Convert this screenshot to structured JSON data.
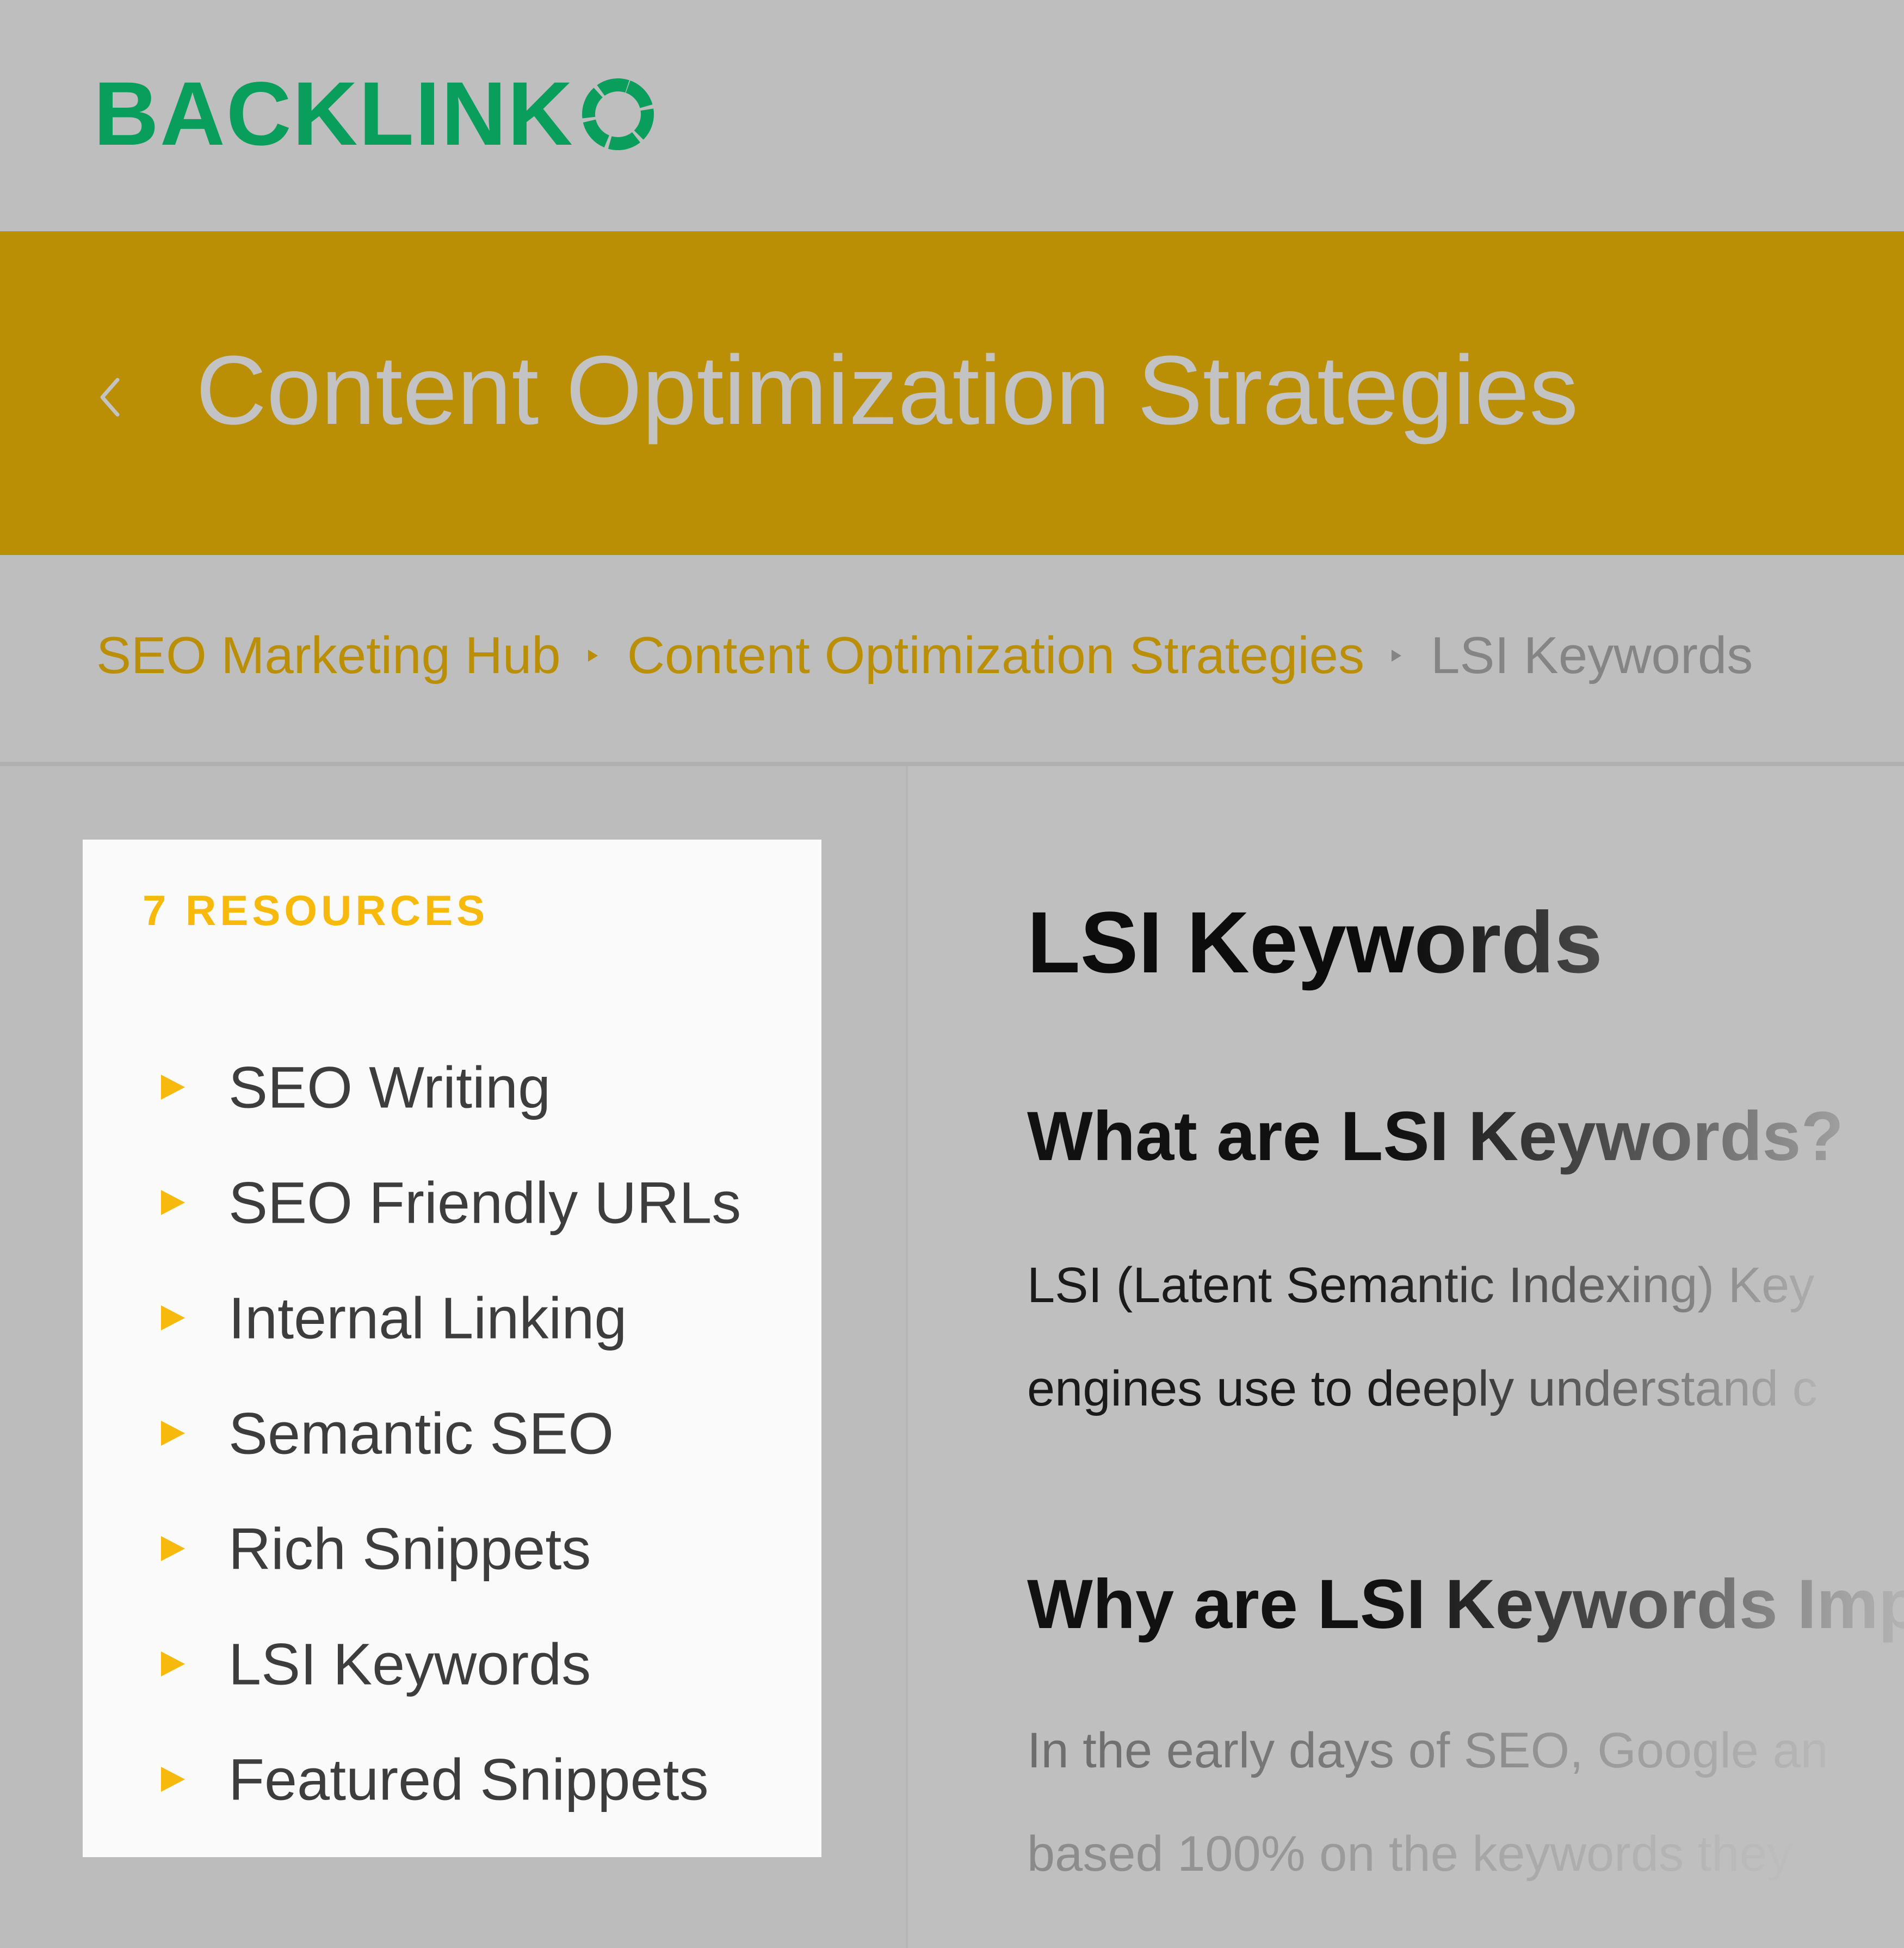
{
  "header": {
    "logo_text": "BACKLINK",
    "logo_color": "#0a9e5d"
  },
  "banner": {
    "title": "Content Optimization Strategies",
    "color": "#bb8f05"
  },
  "breadcrumb": {
    "items": [
      "SEO Marketing Hub",
      "Content Optimization Strategies"
    ],
    "current": "LSI Keywords"
  },
  "sidebar": {
    "heading": "7 RESOURCES",
    "items": [
      {
        "label": "SEO Writing"
      },
      {
        "label": "SEO Friendly URLs"
      },
      {
        "label": "Internal Linking"
      },
      {
        "label": "Semantic SEO"
      },
      {
        "label": "Rich Snippets"
      },
      {
        "label": "LSI Keywords"
      },
      {
        "label": "Featured Snippets"
      }
    ],
    "accent": "#f7b90b"
  },
  "article": {
    "title": "LSI Keywords",
    "section1_heading": "What are LSI Keywords?",
    "section1_line1": "LSI (Latent Semantic Indexing) Key",
    "section1_line2": "engines use to deeply understand c",
    "section2_heading": "Why are LSI Keywords Imp",
    "section2_line1": "In the early days of SEO, Google an",
    "section2_line2": "based 100% on the keywords they"
  }
}
